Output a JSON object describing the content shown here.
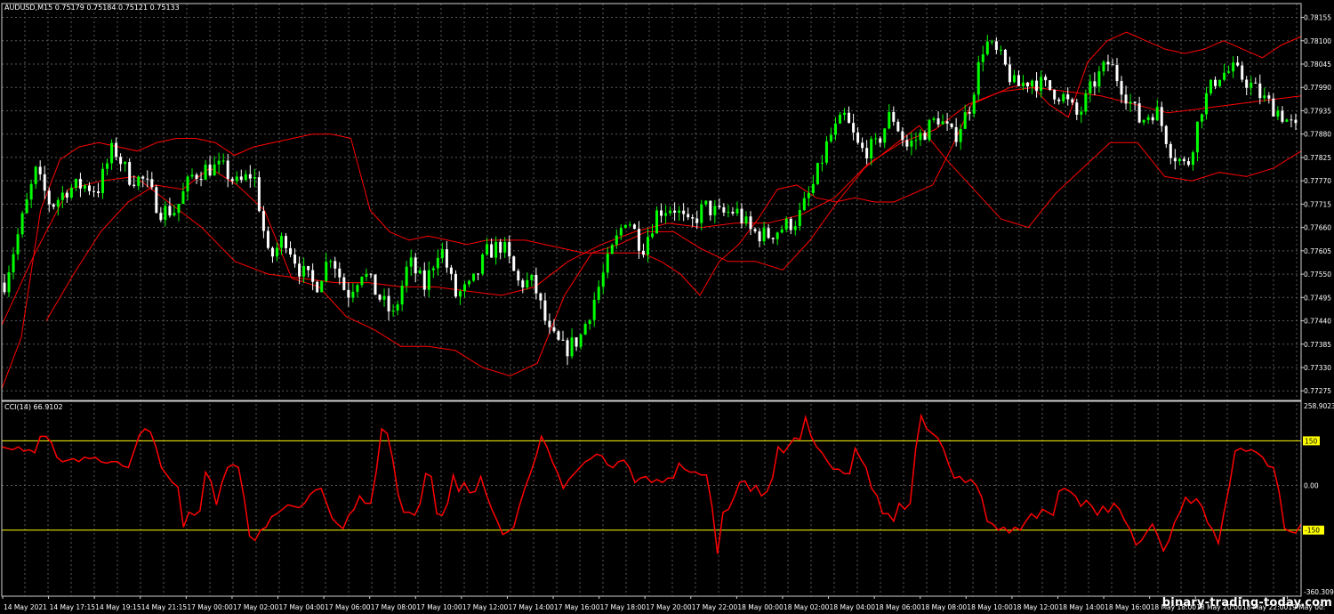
{
  "header": {
    "symbol_info": "AUDUSD,M15  0.75179 0.75184 0.75121 0.75133"
  },
  "cci_header": {
    "label": "CCI(14) 66.9102"
  },
  "colors": {
    "background": "#000000",
    "grid": "#5a5a5a",
    "bull_candle": "#00ff00",
    "bear_candle": "#ffffff",
    "bands": "#ff0000",
    "cci_line": "#ff0000",
    "levels": "#ffff00",
    "text": "#ffffff"
  },
  "price_axis": {
    "ticks": [
      "0.78155",
      "0.78100",
      "0.78045",
      "0.77990",
      "0.77935",
      "0.77880",
      "0.77825",
      "0.77770",
      "0.77715",
      "0.77660",
      "0.77605",
      "0.77550",
      "0.77495",
      "0.77440",
      "0.77385",
      "0.77330",
      "0.77275"
    ]
  },
  "cci_axis": {
    "top_label": "258.9023",
    "level_high": "150",
    "zero": "0.00",
    "level_low": "-150",
    "bottom_label": "-360.3099"
  },
  "time_axis": {
    "labels": [
      "14 May 2021",
      "14 May 17:15",
      "14 May 19:15",
      "14 May 21:15",
      "17 May 00:00",
      "17 May 02:00",
      "17 May 04:00",
      "17 May 06:00",
      "17 May 08:00",
      "17 May 10:00",
      "17 May 12:00",
      "17 May 14:00",
      "17 May 16:00",
      "17 May 18:00",
      "17 May 20:00",
      "17 May 22:00",
      "18 May 00:00",
      "18 May 02:00",
      "18 May 04:00",
      "18 May 06:00",
      "18 May 08:00",
      "18 May 10:00",
      "18 May 12:00",
      "18 May 14:00",
      "18 May 16:00",
      "18 May 18:00",
      "18 May 20:00",
      "18 May 22:00",
      "19 May 00:"
    ]
  },
  "watermark": "binary-trading-today.com",
  "chart_data": [
    {
      "type": "candlestick",
      "title": "AUDUSD,M15",
      "ylim": [
        0.77265,
        0.78175
      ],
      "close_path": [
        0.7753,
        0.7766,
        0.7779,
        0.7771,
        0.7775,
        0.7776,
        0.7775,
        0.7785,
        0.7778,
        0.7777,
        0.777,
        0.777,
        0.7778,
        0.778,
        0.778,
        0.7776,
        0.7779,
        0.7758,
        0.7764,
        0.7756,
        0.7752,
        0.776,
        0.775,
        0.7756,
        0.775,
        0.7745,
        0.7758,
        0.7752,
        0.7762,
        0.775,
        0.7752,
        0.776,
        0.7762,
        0.7753,
        0.7753,
        0.7741,
        0.7737,
        0.774,
        0.775,
        0.776,
        0.7769,
        0.7761,
        0.777,
        0.7771,
        0.7766,
        0.7771,
        0.7769,
        0.777,
        0.7765,
        0.7764,
        0.7766,
        0.7768,
        0.7776,
        0.7787,
        0.7792,
        0.7784,
        0.7785,
        0.7793,
        0.7785,
        0.7788,
        0.7792,
        0.7787,
        0.7794,
        0.781,
        0.7806,
        0.7799,
        0.7801,
        0.7799,
        0.7797,
        0.7792,
        0.78,
        0.7805,
        0.7798,
        0.7791,
        0.7794,
        0.7784,
        0.778,
        0.7795,
        0.7802,
        0.7803,
        0.78,
        0.7796,
        0.7793,
        0.7789
      ],
      "upper_band_path": [
        0.7728,
        0.774,
        0.777,
        0.7782,
        0.7785,
        0.7786,
        0.7785,
        0.7784,
        0.7786,
        0.7787,
        0.7787,
        0.7786,
        0.7783,
        0.7785,
        0.7786,
        0.7787,
        0.7788,
        0.7788,
        0.7787,
        0.777,
        0.7765,
        0.7763,
        0.7764,
        0.7763,
        0.7762,
        0.7763,
        0.7763,
        0.7763,
        0.7762,
        0.7761,
        0.776,
        0.776,
        0.776,
        0.776,
        0.7758,
        0.7755,
        0.775,
        0.7758,
        0.7762,
        0.7768,
        0.7775,
        0.7776,
        0.7773,
        0.7772,
        0.7773,
        0.7772,
        0.7772,
        0.7774,
        0.7776,
        0.7785,
        0.7795,
        0.7797,
        0.7799,
        0.78,
        0.7795,
        0.7792,
        0.7805,
        0.781,
        0.7812,
        0.781,
        0.7808,
        0.7807,
        0.7808,
        0.781,
        0.7808,
        0.7806,
        0.7809,
        0.7811
      ],
      "lower_band_path": [
        0.7744,
        0.7755,
        0.7765,
        0.7772,
        0.7776,
        0.7775,
        0.778,
        0.7776,
        0.777,
        0.7754,
        0.7752,
        0.7745,
        0.7742,
        0.7738,
        0.7738,
        0.7737,
        0.7733,
        0.7731,
        0.7734,
        0.775,
        0.776,
        0.7762,
        0.7765,
        0.7765,
        0.7761,
        0.7758,
        0.7758,
        0.7756,
        0.7763,
        0.7772,
        0.778,
        0.7785,
        0.779,
        0.7782,
        0.7775,
        0.7768,
        0.7766,
        0.7774,
        0.778,
        0.7786,
        0.7786,
        0.7778,
        0.7777,
        0.7779,
        0.7778,
        0.778,
        0.7784
      ],
      "middle_band_path": [
        0.7743,
        0.776,
        0.7775,
        0.7777,
        0.7778,
        0.7772,
        0.7766,
        0.7758,
        0.7755,
        0.7754,
        0.7753,
        0.7753,
        0.7752,
        0.7752,
        0.7751,
        0.775,
        0.7752,
        0.7758,
        0.7762,
        0.7765,
        0.7767,
        0.7766,
        0.7767,
        0.7767,
        0.7769,
        0.7773,
        0.7781,
        0.7786,
        0.7789,
        0.7795,
        0.7798,
        0.7799,
        0.7798,
        0.7797,
        0.7795,
        0.7793,
        0.7794,
        0.7795,
        0.7796,
        0.7797
      ]
    },
    {
      "type": "line",
      "title": "CCI(14) 66.9102",
      "ylim": [
        -360.3099,
        258.9023
      ],
      "levels": [
        150,
        0,
        -150
      ],
      "values": [
        130,
        125,
        120,
        130,
        115,
        120,
        110,
        165,
        165,
        145,
        95,
        80,
        85,
        90,
        80,
        95,
        90,
        95,
        80,
        75,
        80,
        80,
        65,
        60,
        115,
        170,
        190,
        180,
        130,
        60,
        35,
        10,
        -5,
        -140,
        -90,
        -100,
        -85,
        45,
        15,
        -65,
        10,
        60,
        70,
        60,
        -40,
        -170,
        -185,
        -150,
        -140,
        -105,
        -95,
        -80,
        -65,
        -70,
        -75,
        -60,
        -30,
        -15,
        -10,
        -60,
        -110,
        -130,
        -145,
        -100,
        -80,
        -35,
        -60,
        -60,
        45,
        190,
        175,
        90,
        -30,
        -90,
        -90,
        -100,
        -60,
        40,
        30,
        -95,
        -100,
        -60,
        35,
        -20,
        10,
        -25,
        -20,
        30,
        -30,
        -80,
        -120,
        -165,
        -155,
        -140,
        -70,
        -10,
        40,
        95,
        165,
        130,
        80,
        40,
        -10,
        20,
        40,
        60,
        80,
        90,
        105,
        100,
        70,
        60,
        80,
        85,
        60,
        10,
        25,
        30,
        10,
        20,
        10,
        25,
        25,
        75,
        55,
        45,
        45,
        35,
        35,
        -70,
        -230,
        -90,
        -80,
        -40,
        10,
        15,
        -20,
        0,
        -35,
        -20,
        25,
        130,
        110,
        135,
        160,
        155,
        230,
        165,
        130,
        110,
        80,
        55,
        55,
        40,
        40,
        125,
        90,
        60,
        -10,
        -35,
        -95,
        -95,
        -120,
        -60,
        -80,
        -60,
        125,
        235,
        190,
        175,
        160,
        125,
        70,
        25,
        30,
        10,
        20,
        0,
        -40,
        -120,
        -130,
        -150,
        -140,
        -160,
        -140,
        -150,
        -120,
        -95,
        -110,
        -80,
        -90,
        -100,
        -20,
        -10,
        -20,
        -35,
        -70,
        -50,
        -70,
        -100,
        -70,
        -90,
        -60,
        -80,
        -120,
        -150,
        -200,
        -185,
        -155,
        -130,
        -170,
        -220,
        -185,
        -125,
        -90,
        -40,
        -60,
        -45,
        -70,
        -125,
        -150,
        -195,
        -90,
        0,
        115,
        125,
        115,
        120,
        110,
        95,
        65,
        60,
        -20,
        -145,
        -155,
        -160,
        -130
      ]
    }
  ]
}
